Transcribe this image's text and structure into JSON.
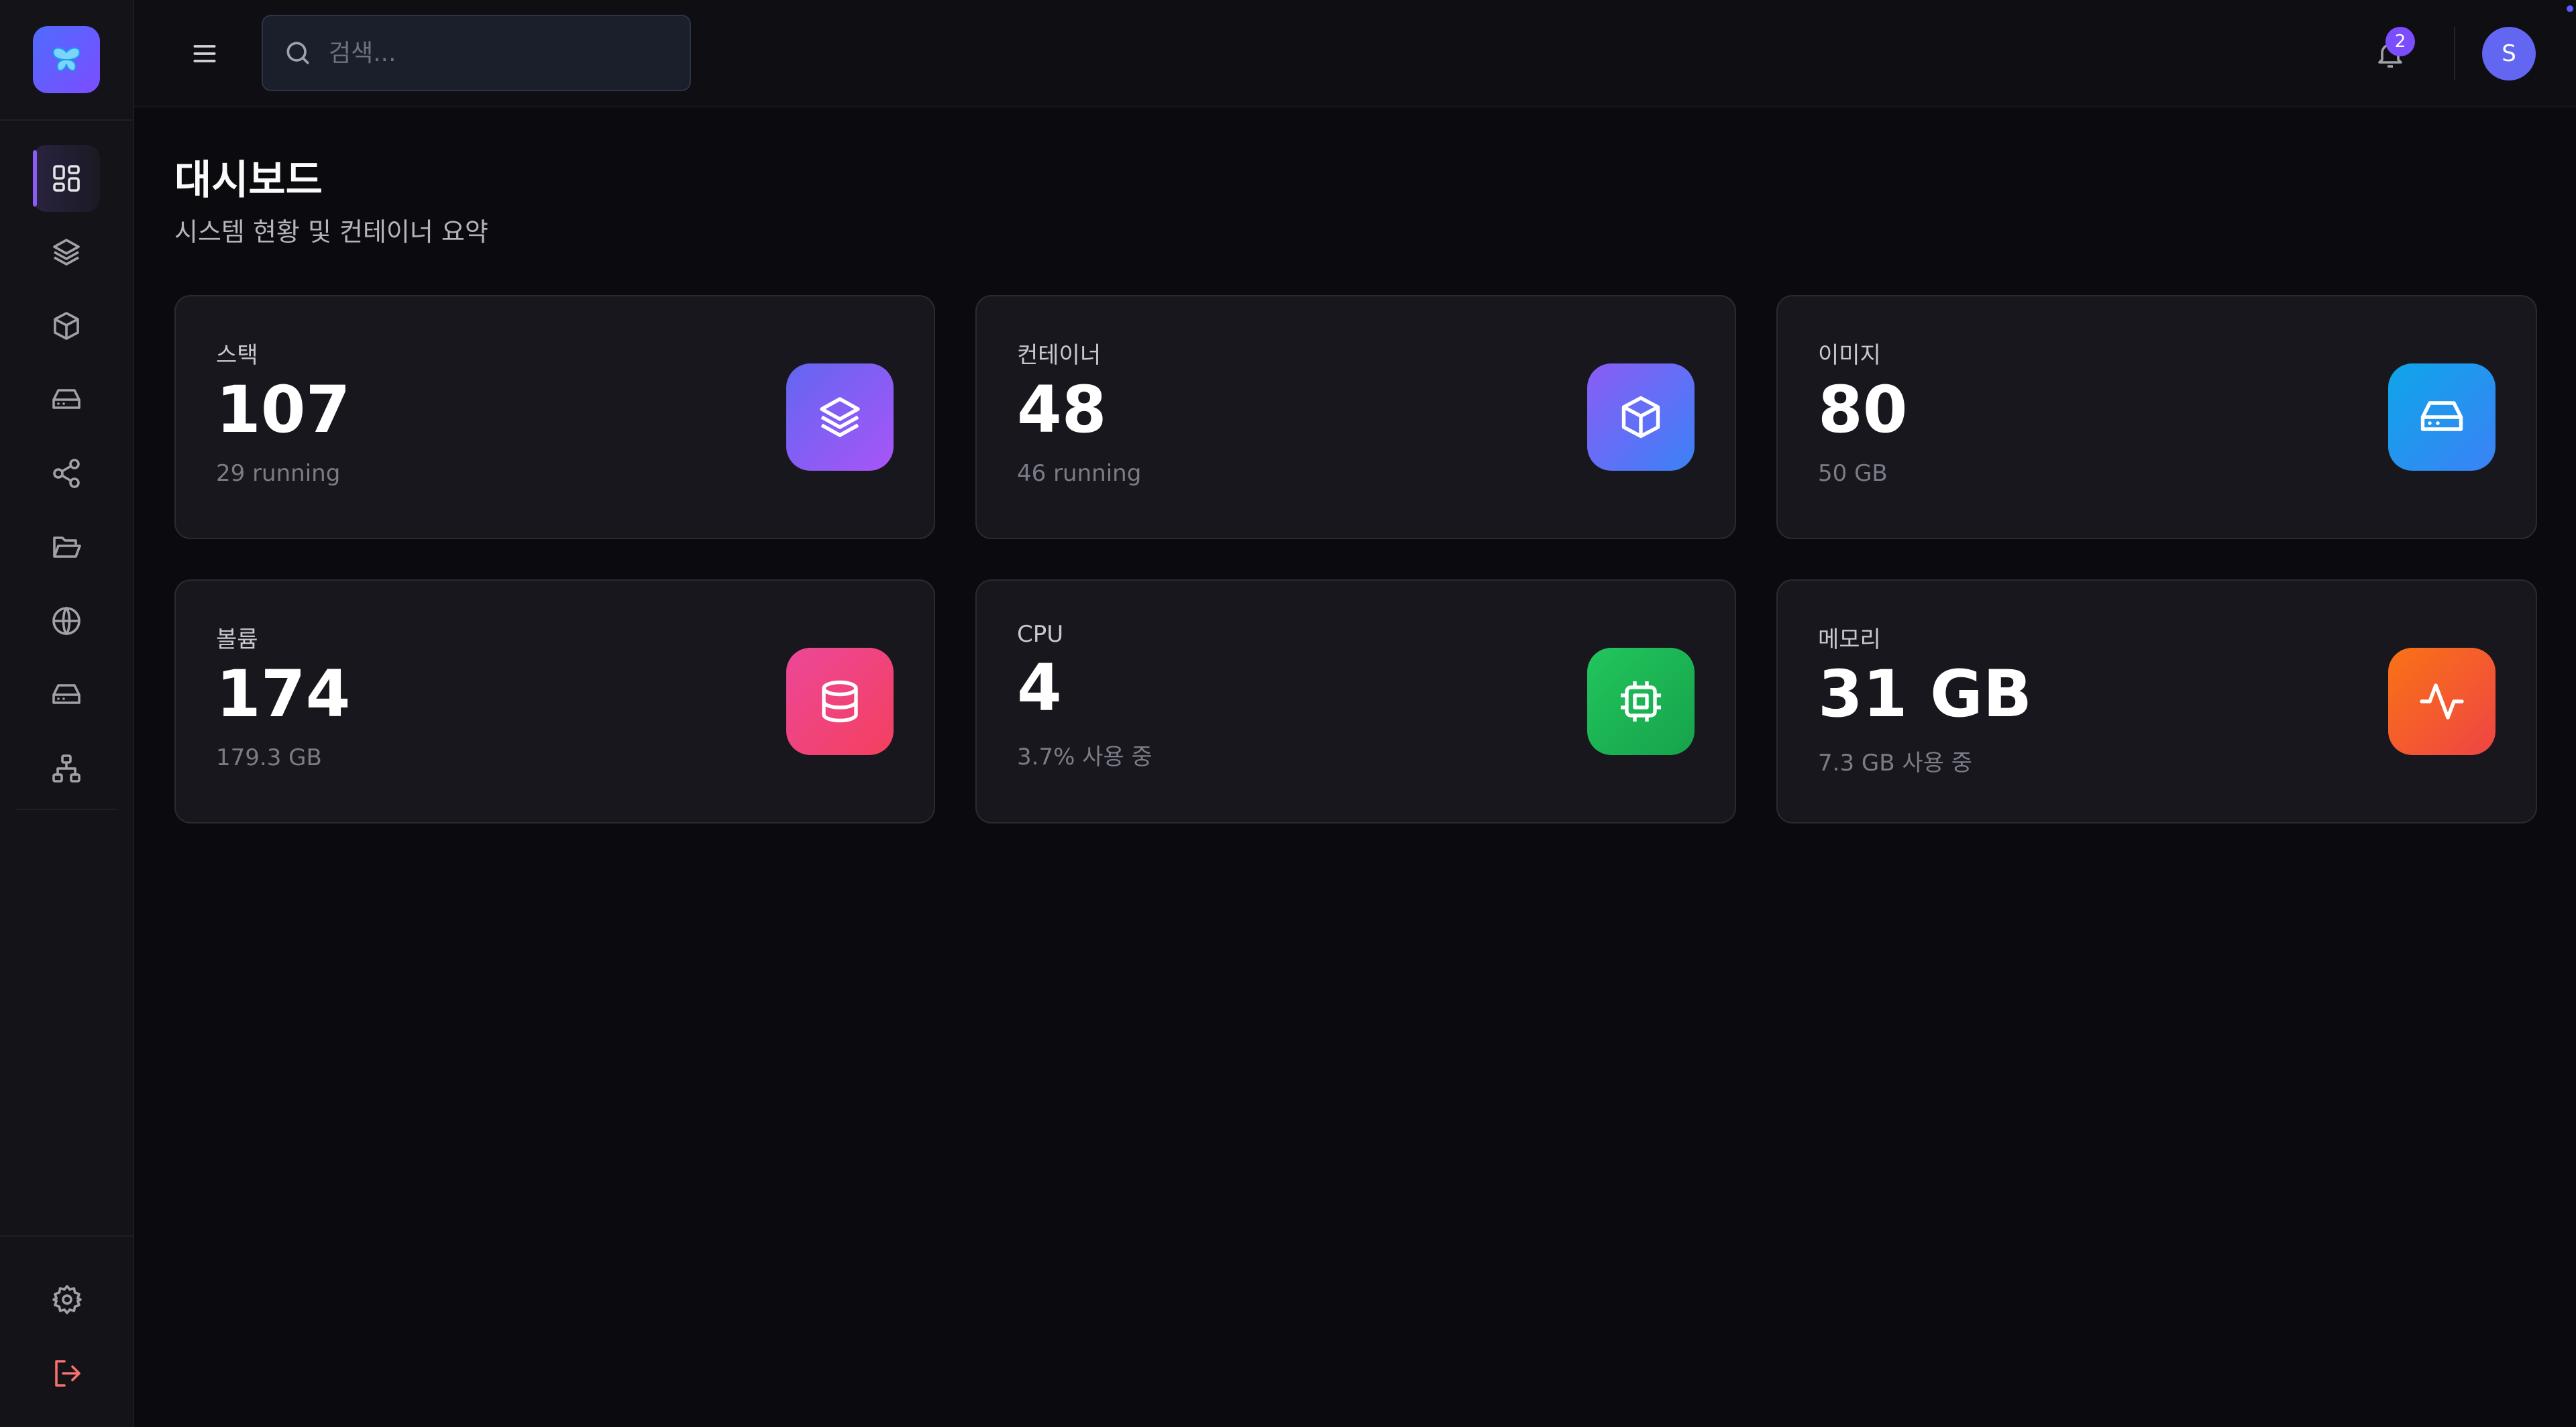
{
  "topbar": {
    "search_placeholder": "검색...",
    "notification_count": "2",
    "avatar_initial": "S"
  },
  "sidebar": {
    "items": [
      {
        "icon": "dashboard-icon",
        "active": true
      },
      {
        "icon": "layers-icon"
      },
      {
        "icon": "box-icon"
      },
      {
        "icon": "hard-drive-icon"
      },
      {
        "icon": "share-icon"
      },
      {
        "icon": "folder-open-icon"
      },
      {
        "icon": "globe-icon"
      },
      {
        "icon": "hard-drive-icon"
      },
      {
        "icon": "network-icon"
      }
    ],
    "bottom": [
      {
        "icon": "gear-icon"
      },
      {
        "icon": "logout-icon",
        "color": "#f87171"
      }
    ]
  },
  "page": {
    "title": "대시보드",
    "subtitle": "시스템 현황 및 컨테이너 요약"
  },
  "cards": [
    {
      "label": "스택",
      "value": "107",
      "sub": "29 running",
      "icon": "layers-icon",
      "gradient": [
        "#6366f1",
        "#a855f7"
      ]
    },
    {
      "label": "컨테이너",
      "value": "48",
      "sub": "46 running",
      "icon": "box-icon",
      "gradient": [
        "#8b5cf6",
        "#3b82f6"
      ]
    },
    {
      "label": "이미지",
      "value": "80",
      "sub": "50 GB",
      "icon": "hard-drive-icon",
      "gradient": [
        "#0ea5e9",
        "#3b82f6"
      ]
    },
    {
      "label": "볼륨",
      "value": "174",
      "sub": "179.3 GB",
      "icon": "database-icon",
      "gradient": [
        "#ec4899",
        "#f43f5e"
      ]
    },
    {
      "label": "CPU",
      "value": "4",
      "sub": "3.7% 사용 중",
      "icon": "cpu-icon",
      "gradient": [
        "#22c55e",
        "#16a34a"
      ]
    },
    {
      "label": "메모리",
      "value": "31 GB",
      "sub": "7.3 GB 사용 중",
      "icon": "activity-icon",
      "gradient": [
        "#f97316",
        "#ef4444"
      ]
    }
  ]
}
